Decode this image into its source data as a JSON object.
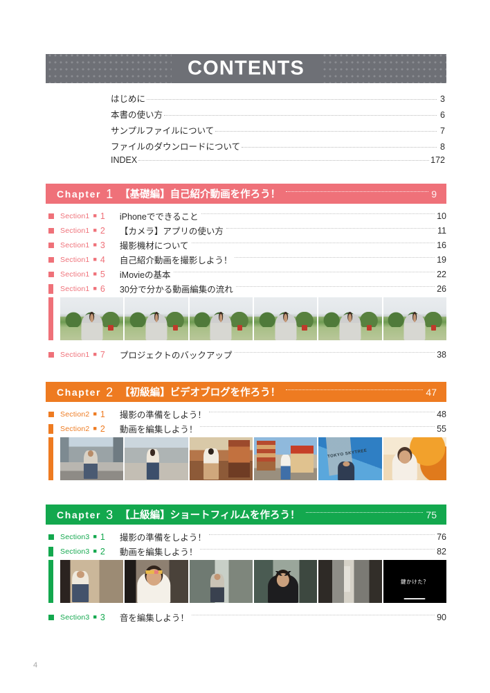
{
  "header": {
    "title": "CONTENTS",
    "banner_color": "#6e7076",
    "dot_color": "#8a8c91"
  },
  "front_matter": [
    {
      "label": "はじめに",
      "page": "3"
    },
    {
      "label": "本書の使い方",
      "page": "6"
    },
    {
      "label": "サンプルファイルについて",
      "page": "7"
    },
    {
      "label": "ファイルのダウンロードについて",
      "page": "8"
    },
    {
      "label": "INDEX",
      "page": "172"
    }
  ],
  "chapters": [
    {
      "word": "Chapter",
      "number": "1",
      "title": "【基礎編】自己紹介動画を作ろう！",
      "page": "9",
      "color": "#ef7179",
      "sections": [
        {
          "name": "Section1",
          "sep": "■",
          "index": "1",
          "title": "iPhoneでできること",
          "page": "10"
        },
        {
          "name": "Section1",
          "sep": "■",
          "index": "2",
          "title": "【カメラ】アプリの使い方",
          "page": "11"
        },
        {
          "name": "Section1",
          "sep": "■",
          "index": "3",
          "title": "撮影機材について",
          "page": "16"
        },
        {
          "name": "Section1",
          "sep": "■",
          "index": "4",
          "title": "自己紹介動画を撮影しよう！",
          "page": "19"
        },
        {
          "name": "Section1",
          "sep": "■",
          "index": "5",
          "title": "iMovieの基本",
          "page": "22"
        },
        {
          "name": "Section1",
          "sep": "■",
          "index": "6",
          "title": "30分で分かる動画編集の流れ",
          "page": "26"
        }
      ],
      "filmstrip": [
        {
          "scene": "sc-outdoor",
          "caption": ""
        },
        {
          "scene": "sc-outdoor",
          "caption": ""
        },
        {
          "scene": "sc-outdoor",
          "caption": ""
        },
        {
          "scene": "sc-outdoor",
          "caption": ""
        },
        {
          "scene": "sc-outdoor",
          "caption": ""
        },
        {
          "scene": "sc-outdoor",
          "caption": ""
        }
      ],
      "sections_after": [
        {
          "name": "Section1",
          "sep": "■",
          "index": "7",
          "title": "プロジェクトのバックアップ",
          "page": "38"
        }
      ]
    },
    {
      "word": "Chapter",
      "number": "2",
      "title": "【初級編】ビデオブログを作ろう！",
      "page": "47",
      "color": "#ee7b21",
      "sections": [
        {
          "name": "Section2",
          "sep": "■",
          "index": "1",
          "title": "撮影の準備をしよう！",
          "page": "48"
        },
        {
          "name": "Section2",
          "sep": "■",
          "index": "2",
          "title": "動画を編集しよう！",
          "page": "55"
        }
      ],
      "filmstrip": [
        {
          "scene": "sc-street",
          "caption": ""
        },
        {
          "scene": "sc-walk",
          "caption": ""
        },
        {
          "scene": "sc-temple",
          "caption": ""
        },
        {
          "scene": "sc-pagoda",
          "caption": ""
        },
        {
          "scene": "sc-tower",
          "caption": "TOKYO SKYTREE"
        },
        {
          "scene": "sc-autumn",
          "caption": ""
        }
      ],
      "sections_after": []
    },
    {
      "word": "Chapter",
      "number": "3",
      "title": "【上級編】ショートフィルムを作ろう！",
      "page": "75",
      "color": "#13a84e",
      "sections": [
        {
          "name": "Section3",
          "sep": "■",
          "index": "1",
          "title": "撮影の準備をしよう！",
          "page": "76"
        },
        {
          "name": "Section3",
          "sep": "■",
          "index": "2",
          "title": "動画を編集しよう！",
          "page": "82"
        }
      ],
      "filmstrip": [
        {
          "scene": "sc-room",
          "caption": ""
        },
        {
          "scene": "sc-closeup",
          "caption": ""
        },
        {
          "scene": "sc-hall",
          "caption": ""
        },
        {
          "scene": "sc-devil",
          "caption": ""
        },
        {
          "scene": "sc-corridor",
          "caption": ""
        },
        {
          "scene": "sc-black",
          "caption": "鍵かけた？"
        }
      ],
      "sections_after": [
        {
          "name": "Section3",
          "sep": "■",
          "index": "3",
          "title": "音を編集しよう！",
          "page": "90"
        }
      ]
    }
  ],
  "folio": "4"
}
